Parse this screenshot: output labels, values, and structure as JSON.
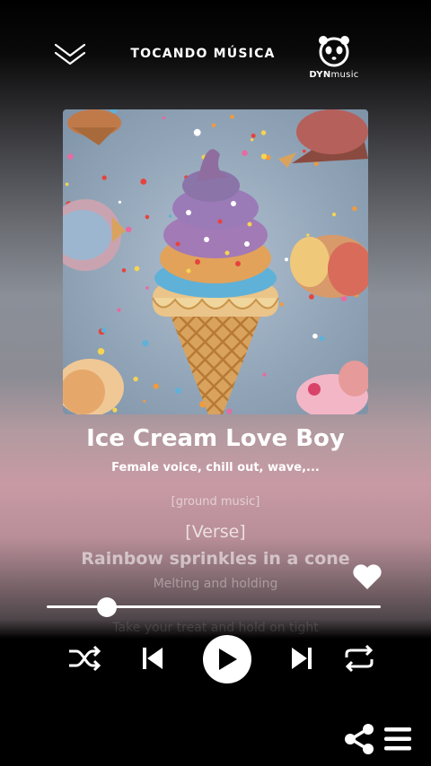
{
  "header": {
    "title": "TOCANDO MÚSICA",
    "collapse_icon": "chevron-double-down-icon",
    "logo_bold": "DYN",
    "logo_light": "music"
  },
  "song": {
    "title": "Ice Cream Love Boy",
    "subtitle": "Female voice, chill out, wave,..."
  },
  "lyrics": [
    "[ground music]",
    "[Verse]",
    "Rainbow sprinkles in a cone",
    "Melting and holding",
    "",
    "Take your treat and hold on tight"
  ],
  "player": {
    "progress": 0.18,
    "liked": true,
    "controls": [
      "shuffle-icon",
      "previous-icon",
      "play-icon",
      "next-icon",
      "repeat-icon"
    ]
  },
  "colors": {
    "accent": "#ffffff",
    "background_top": "#000000",
    "background_mid": "#8a8f98",
    "background_pink": "#c89aa4"
  }
}
